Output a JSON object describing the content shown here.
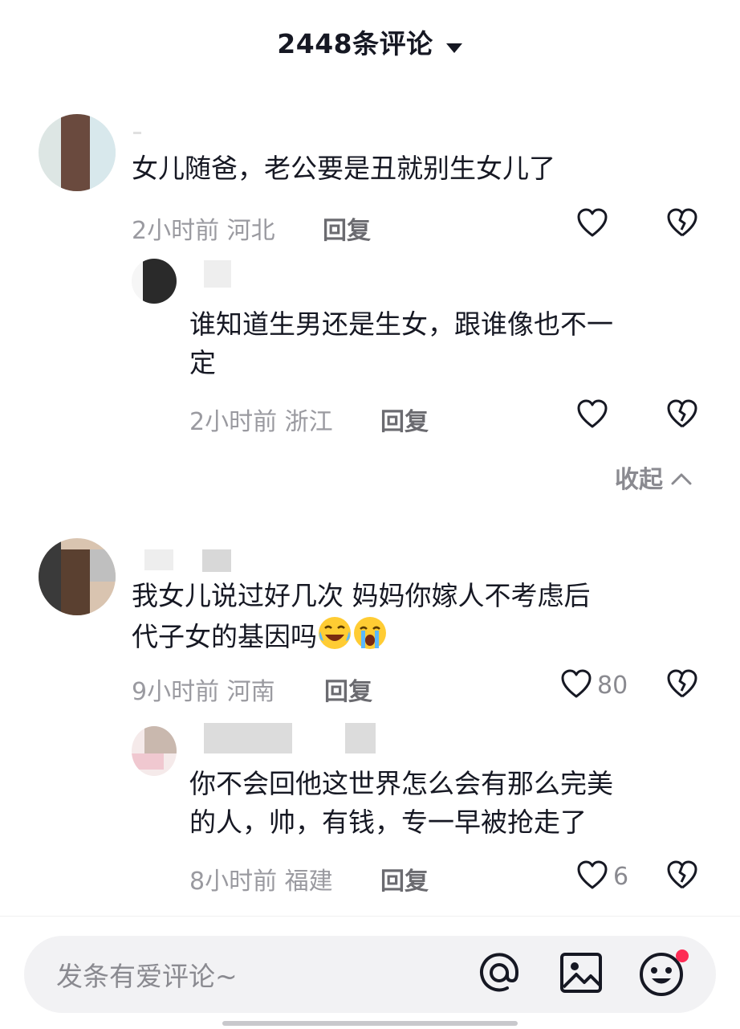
{
  "header": {
    "title": "2448条评论"
  },
  "comments": [
    {
      "text": "女儿随爸，老公要是丑就别生女儿了",
      "time": "2小时前",
      "location": "河北",
      "reply_label": "回复",
      "likes": ""
    },
    {
      "text_line1": "谁知道生男还是生女，跟谁像也不一",
      "text_line2": "定",
      "time": "2小时前",
      "location": "浙江",
      "reply_label": "回复",
      "likes": ""
    },
    {
      "text_line1": "我女儿说过好几次 妈妈你嫁人不考虑后",
      "text_line2": "代子女的基因吗",
      "time": "9小时前",
      "location": "河南",
      "reply_label": "回复",
      "likes": "80"
    },
    {
      "text_line1": "你不会回他这世界怎么会有那么完美",
      "text_line2": "的人，帅，有钱，专一早被抢走了",
      "time": "8小时前",
      "location": "福建",
      "reply_label": "回复",
      "likes": "6"
    }
  ],
  "collapse_label": "收起",
  "input": {
    "placeholder": "发条有爱评论~"
  },
  "icons": [
    "chevron-down-icon",
    "heart-icon",
    "broken-heart-icon",
    "chevron-up-icon",
    "at-icon",
    "image-icon",
    "emoji-icon",
    "laughing-emoji-icon",
    "crying-emoji-icon"
  ],
  "colors": {
    "text": "#161823",
    "meta": "#9a9aa0",
    "notification_dot": "#fe2c55"
  }
}
